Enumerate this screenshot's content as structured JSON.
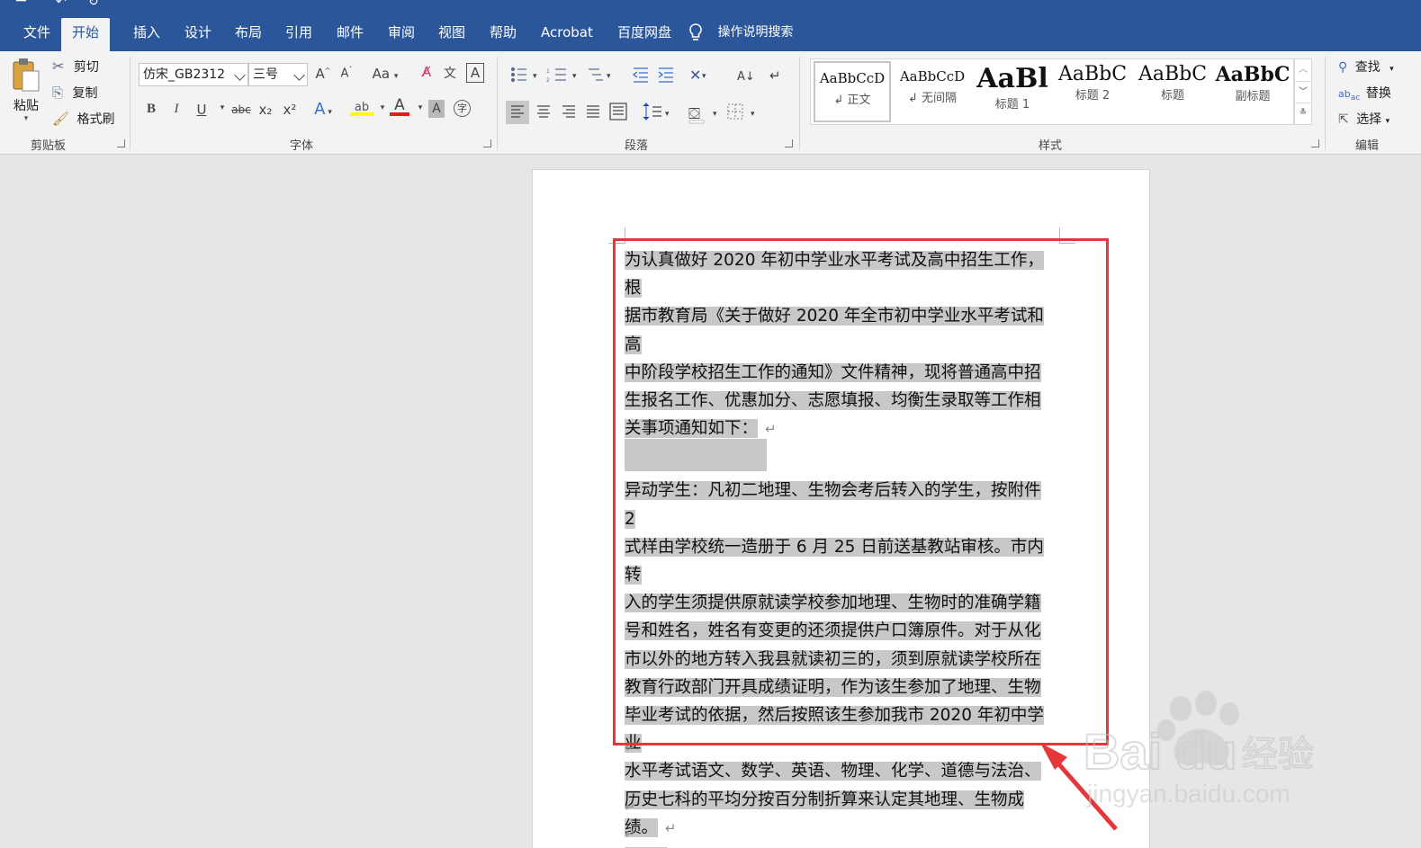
{
  "tabs": [
    "文件",
    "开始",
    "插入",
    "设计",
    "布局",
    "引用",
    "邮件",
    "审阅",
    "视图",
    "帮助",
    "Acrobat",
    "百度网盘"
  ],
  "active_tab": "开始",
  "tell_me": "操作说明搜索",
  "clipboard": {
    "paste": "粘贴",
    "cut": "剪切",
    "copy": "复制",
    "format_painter": "格式刷",
    "label": "剪贴板"
  },
  "font": {
    "name": "仿宋_GB2312",
    "size": "三号",
    "label": "字体",
    "change_case": "Aa",
    "bold": "B",
    "italic": "I",
    "underline": "U",
    "strike": "abc",
    "subscript": "x₂",
    "superscript": "x²",
    "font_color_letter": "A",
    "grow": "A",
    "shrink": "A",
    "phonetic": "文"
  },
  "paragraph": {
    "label": "段落"
  },
  "styles": {
    "label": "样式",
    "items": [
      {
        "sample": "AaBbCcD",
        "name": "↲ 正文"
      },
      {
        "sample": "AaBbCcD",
        "name": "↲ 无间隔"
      },
      {
        "sample": "AaBl",
        "name": "标题 1"
      },
      {
        "sample": "AaBbC",
        "name": "标题 2"
      },
      {
        "sample": "AaBbC",
        "name": "标题"
      },
      {
        "sample": "AaBbC",
        "name": "副标题"
      }
    ]
  },
  "editing": {
    "label": "编辑",
    "find": "查找",
    "replace": "替换",
    "select": "选择"
  },
  "document": {
    "para1_lines": [
      "为认真做好 2020 年初中学业水平考试及高中招生工作，根",
      "据市教育局《关于做好 2020 年全市初中学业水平考试和高",
      "中阶段学校招生工作的通知》文件精神，现将普通高中招",
      "生报名工作、优惠加分、志愿填报、均衡生录取等工作相",
      "关事项通知如下："
    ],
    "para2_lines": [
      "异动学生：凡初二地理、生物会考后转入的学生，按附件 2",
      "式样由学校统一造册于 6 月 25 日前送基教站审核。市内转",
      "入的学生须提供原就读学校参加地理、生物时的准确学籍",
      "号和姓名，姓名有变更的还须提供户口簿原件。对于从化",
      "市以外的地方转入我县就读初三的，须到原就读学校所在",
      "教育行政部门开具成绩证明，作为该生参加了地理、生物",
      "毕业考试的依据，然后按照该生参加我市 2020 年初中学业",
      "水平考试语文、数学、英语、物理、化学、道德与法治、",
      "历史七科的平均分按百分制折算来认定其地理、生物成",
      "绩。"
    ],
    "para_mark": "↵"
  },
  "watermark": {
    "logo": "Bai du 经验",
    "url": "jingyan.baidu.com"
  }
}
